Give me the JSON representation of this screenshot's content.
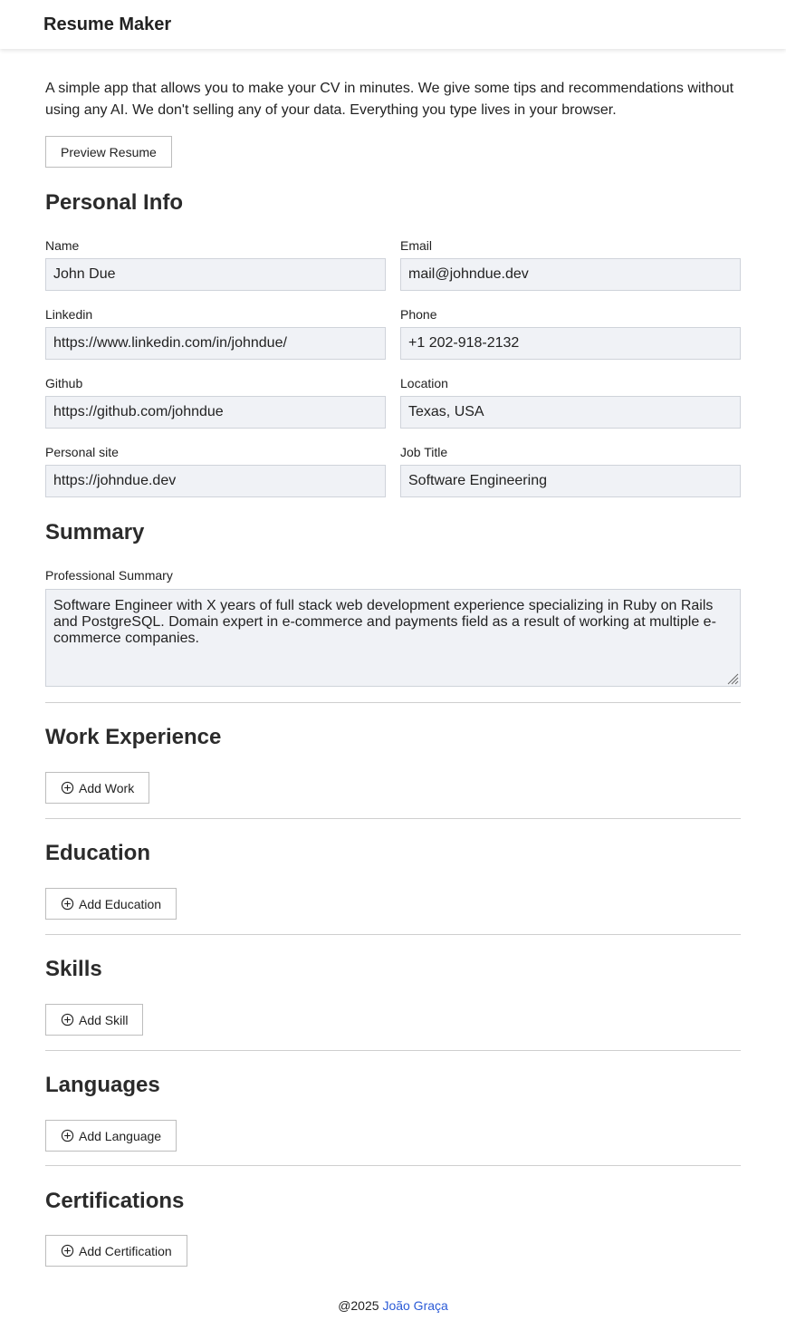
{
  "header": {
    "brand": "Resume Maker"
  },
  "intro": {
    "text": "A simple app that allows you to make your CV in minutes. We give some tips and recommendations without using any AI. We don't selling any of your data. Everything you type lives in your browser.",
    "preview_button": "Preview Resume"
  },
  "personal_info": {
    "heading": "Personal Info",
    "name": {
      "label": "Name",
      "value": "John Due"
    },
    "email": {
      "label": "Email",
      "value": "mail@johndue.dev"
    },
    "linkedin": {
      "label": "Linkedin",
      "value": "https://www.linkedin.com/in/johndue/"
    },
    "phone": {
      "label": "Phone",
      "value": "+1 202-918-2132"
    },
    "github": {
      "label": "Github",
      "value": "https://github.com/johndue"
    },
    "location": {
      "label": "Location",
      "value": "Texas, USA"
    },
    "site": {
      "label": "Personal site",
      "value": "https://johndue.dev"
    },
    "job_title": {
      "label": "Job Title",
      "value": "Software Engineering"
    }
  },
  "summary": {
    "heading": "Summary",
    "label": "Professional Summary",
    "value": "Software Engineer with X years of full stack web development experience specializing in Ruby on Rails and PostgreSQL. Domain expert in e-commerce and payments field as a result of working at multiple e-commerce companies."
  },
  "work": {
    "heading": "Work Experience",
    "button": "Add Work"
  },
  "education": {
    "heading": "Education",
    "button": "Add Education"
  },
  "skills": {
    "heading": "Skills",
    "button": "Add Skill"
  },
  "languages": {
    "heading": "Languages",
    "button": "Add Language"
  },
  "certifications": {
    "heading": "Certifications",
    "button": "Add Certification"
  },
  "footer": {
    "copyright": "@2025",
    "author": "João Graça"
  },
  "icons": {
    "add": "plus-circle-icon",
    "resize": "resize-grip-icon"
  },
  "colors": {
    "input_bg": "#f0f2f6",
    "link": "#2b5bd7",
    "text": "#222222"
  }
}
